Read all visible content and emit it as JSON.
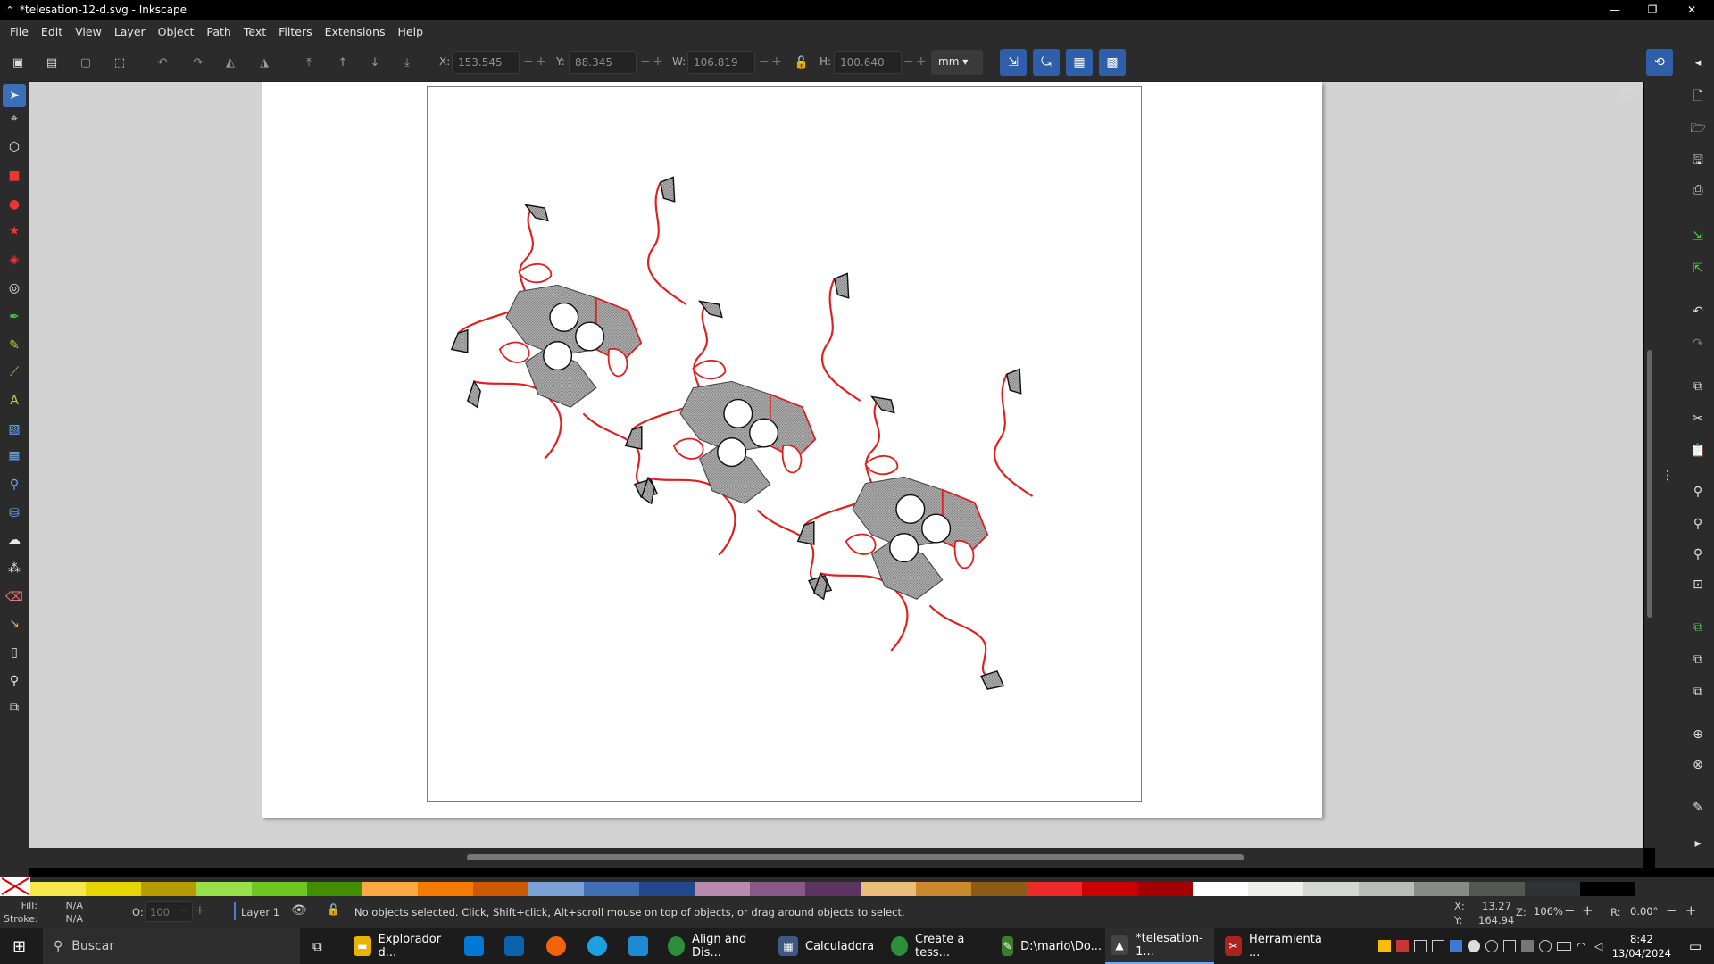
{
  "window": {
    "title": "*telesation-12-d.svg - Inkscape",
    "minimize": "—",
    "restore": "❐",
    "close": "✕"
  },
  "menu": [
    "File",
    "Edit",
    "View",
    "Layer",
    "Object",
    "Path",
    "Text",
    "Filters",
    "Extensions",
    "Help"
  ],
  "toolbar": {
    "x_label": "X:",
    "x_value": "153.545",
    "y_label": "Y:",
    "y_value": "88.345",
    "w_label": "W:",
    "w_value": "106.819",
    "h_label": "H:",
    "h_value": "100.640",
    "unit": "mm"
  },
  "statusbar": {
    "fill_label": "Fill:",
    "fill_value": "N/A",
    "stroke_label": "Stroke:",
    "stroke_value": "N/A",
    "opacity_label": "O:",
    "opacity_value": "100",
    "layer": "Layer 1",
    "message": "No objects selected. Click, Shift+click, Alt+scroll mouse on top of objects, or drag around objects to select.",
    "cursor_x_label": "X:",
    "cursor_x": "13.27",
    "cursor_y_label": "Y:",
    "cursor_y": "164.94",
    "zoom_label": "Z:",
    "zoom": "106%",
    "rotate_label": "R:",
    "rotate": "0.00°"
  },
  "palette": [
    "#f7e84a",
    "#e9d300",
    "#b99a00",
    "#96e04a",
    "#6cc722",
    "#3f8f00",
    "#fda943",
    "#f57a00",
    "#cc5a00",
    "#7ba2d6",
    "#3e70b3",
    "#20488c",
    "#b88ab0",
    "#8a5888",
    "#5c3361",
    "#ebbc7a",
    "#c98a2e",
    "#8d5a17",
    "#ef2929",
    "#cc0000",
    "#a40000",
    "#ffffff",
    "#eeeeec",
    "#d3d7cf",
    "#babdb6",
    "#888a85",
    "#555753",
    "#2e3436",
    "#000000"
  ],
  "taskbar": {
    "search_placeholder": "Buscar",
    "apps": [
      {
        "label": "Explorador d...",
        "color": "#e8b400"
      },
      {
        "label": "Align and Dis...",
        "color": "#2d8f3a"
      },
      {
        "label": "Calculadora",
        "color": "#3d5a80"
      },
      {
        "label": "Create a tess...",
        "color": "#2d8f3a"
      },
      {
        "label": "D:\\mario\\Do...",
        "color": "#3a7d2a"
      },
      {
        "label": "*telesation-1...",
        "color": "#444"
      },
      {
        "label": "Herramienta ...",
        "color": "#aa2222"
      }
    ],
    "time": "8:42",
    "date": "13/04/2024"
  }
}
